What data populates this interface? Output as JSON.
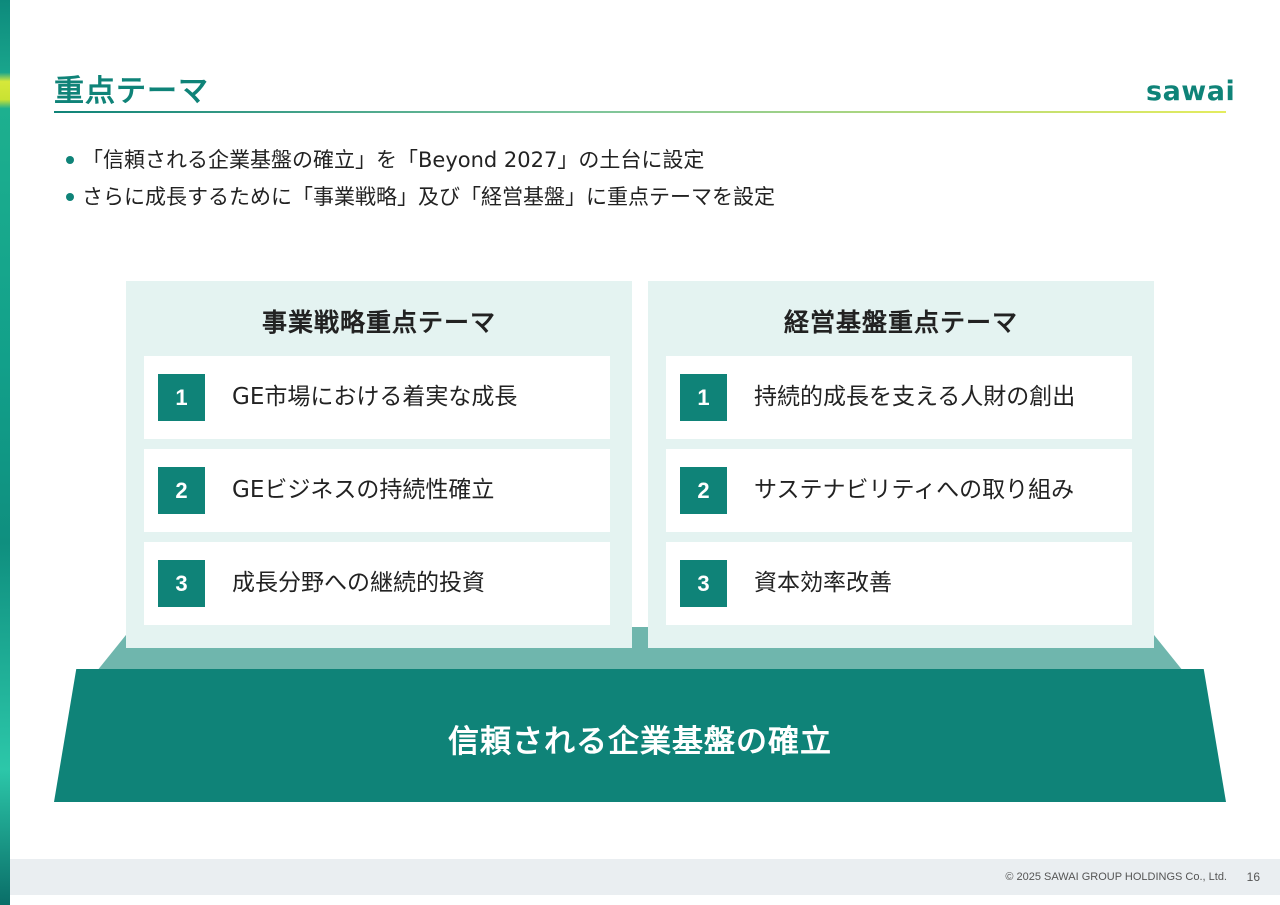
{
  "header": {
    "title": "重点テーマ",
    "logo_text": "sawai"
  },
  "bullets": [
    "「信頼される企業基盤の確立」を「Beyond 2027」の土台に設定",
    "さらに成長するために「事業戦略」及び「経営基盤」に重点テーマを設定"
  ],
  "panels": {
    "left": {
      "title": "事業戦略重点テーマ",
      "items": [
        {
          "num": "1",
          "label": "GE市場における着実な成長"
        },
        {
          "num": "2",
          "label": "GEビジネスの持続性確立"
        },
        {
          "num": "3",
          "label": "成長分野への継続的投資"
        }
      ]
    },
    "right": {
      "title": "経営基盤重点テーマ",
      "items": [
        {
          "num": "1",
          "label": "持続的成長を支える人財の創出"
        },
        {
          "num": "2",
          "label": "サステナビリティへの取り組み"
        },
        {
          "num": "3",
          "label": "資本効率改善"
        }
      ]
    }
  },
  "foundation": {
    "label": "信頼される企業基盤の確立"
  },
  "footer": {
    "copyright": "© 2025 SAWAI GROUP HOLDINGS Co., Ltd.",
    "page_number": "16"
  },
  "colors": {
    "accent": "#0f8378",
    "panel_bg": "#e4f3f1",
    "base_top": "#6fb6ad",
    "footer_bg": "#eaeef1"
  }
}
